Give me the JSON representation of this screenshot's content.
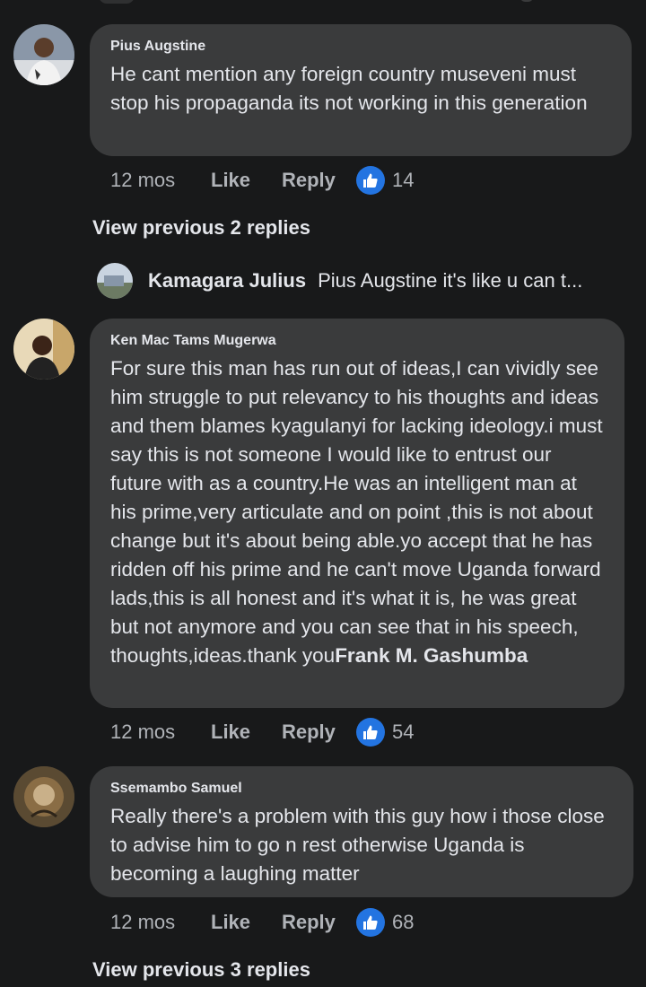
{
  "comments": [
    {
      "author": "Pius Augstine",
      "text": "He cant mention any foreign country museveni must stop his propaganda its not working in this generation",
      "time": "12 mos",
      "like": "Like",
      "reply": "Reply",
      "reaction_count": "14"
    },
    {
      "author": "Ken Mac Tams Mugerwa",
      "text": "For sure this man has run out of ideas,I can vividly see him struggle to put relevancy to his thoughts and ideas and them blames  kyagulanyi for lacking ideology.i must say this is not someone I would like to entrust our future with as a country.He was an intelligent man at his prime,very articulate and on point ,this is not about change but it's about being able.yo accept that he has ridden off his prime and he can't move Uganda  forward lads,this is all honest and it's what it is, he was great but not anymore and you can see that in his speech, thoughts,ideas.thank you",
      "tag": "Frank M. Gashumba",
      "time": "12 mos",
      "like": "Like",
      "reply": "Reply",
      "reaction_count": "54"
    },
    {
      "author": "Ssemambo Samuel",
      "text": "Really there's a problem with this guy  how i those close to advise him to go n rest otherwise Uganda is becoming a laughing matter",
      "time": "12 mos",
      "like": "Like",
      "reply": "Reply",
      "reaction_count": "68"
    }
  ],
  "view_previous_1": "View previous 2 replies",
  "view_previous_2": "View previous 3 replies",
  "reply_preview": {
    "name": "Kamagara Julius",
    "snippet": "Pius Augstine it's like u can t..."
  },
  "colors": {
    "background": "#18191a",
    "bubble": "#3a3b3c",
    "like_blue": "#2374e1"
  }
}
